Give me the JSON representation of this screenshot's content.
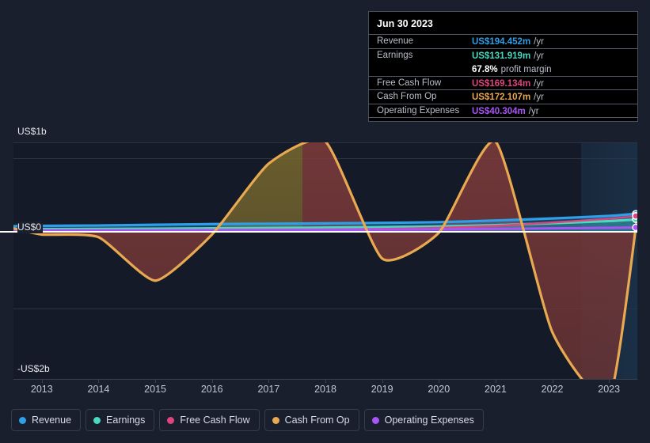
{
  "chart_data": {
    "type": "area",
    "title": "",
    "xlabel": "",
    "ylabel": "",
    "ylim": [
      -2000,
      1000
    ],
    "ytick_labels": [
      "US$1b",
      "US$0",
      "-US$2b"
    ],
    "ytick_values": [
      1000,
      0,
      -2000
    ],
    "grid": true,
    "x": [
      2012.5,
      2013,
      2014,
      2015,
      2016,
      2017,
      2018,
      2019,
      2020,
      2021,
      2022,
      2023,
      2023.5
    ],
    "categories": [
      "2013",
      "2014",
      "2015",
      "2016",
      "2017",
      "2018",
      "2019",
      "2020",
      "2021",
      "2022",
      "2023"
    ],
    "legend_position": "bottom",
    "forecast_band_start": "2022.6",
    "series": [
      {
        "name": "Revenue",
        "color": "#2e9fe8",
        "values": [
          55,
          58,
          62,
          70,
          78,
          82,
          86,
          92,
          100,
          118,
          142,
          170,
          194.452
        ]
      },
      {
        "name": "Earnings",
        "color": "#4ad9c0",
        "values": [
          20,
          22,
          24,
          26,
          30,
          34,
          38,
          44,
          52,
          66,
          88,
          112,
          131.919
        ]
      },
      {
        "name": "Free Cash Flow",
        "color": "#e0447e",
        "values": [
          8,
          10,
          12,
          12,
          14,
          16,
          18,
          24,
          36,
          58,
          96,
          138,
          169.134
        ]
      },
      {
        "name": "Cash From Op",
        "color": "#e8a951",
        "values": [
          30,
          -40,
          -70,
          -560,
          -40,
          760,
          1010,
          -310,
          -20,
          1010,
          -1140,
          -1900,
          172.107
        ]
      },
      {
        "name": "Operating Expenses",
        "color": "#a855f7",
        "values": [
          5,
          6,
          7,
          8,
          9,
          10,
          12,
          14,
          18,
          24,
          30,
          36,
          40.304
        ]
      }
    ]
  },
  "axis": {
    "y_top_label": "US$1b",
    "y_zero_label": "US$0",
    "y_bottom_label": "-US$2b",
    "x_labels": [
      "2013",
      "2014",
      "2015",
      "2016",
      "2017",
      "2018",
      "2019",
      "2020",
      "2021",
      "2022",
      "2023"
    ]
  },
  "legend": {
    "items": [
      {
        "label": "Revenue",
        "color": "#2e9fe8"
      },
      {
        "label": "Earnings",
        "color": "#4ad9c0"
      },
      {
        "label": "Free Cash Flow",
        "color": "#e0447e"
      },
      {
        "label": "Cash From Op",
        "color": "#e8a951"
      },
      {
        "label": "Operating Expenses",
        "color": "#a855f7"
      }
    ]
  },
  "tooltip": {
    "date": "Jun 30 2023",
    "rows": [
      {
        "label": "Revenue",
        "value": "US$194.452m",
        "unit": "/yr",
        "color": "#2e9fe8"
      },
      {
        "label": "Earnings",
        "value": "US$131.919m",
        "unit": "/yr",
        "color": "#4ad9c0"
      },
      {
        "label": "Free Cash Flow",
        "value": "US$169.134m",
        "unit": "/yr",
        "color": "#e0447e"
      },
      {
        "label": "Cash From Op",
        "value": "US$172.107m",
        "unit": "/yr",
        "color": "#e8a951"
      },
      {
        "label": "Operating Expenses",
        "value": "US$40.304m",
        "unit": "/yr",
        "color": "#a855f7"
      }
    ],
    "profit_margin_value": "67.8%",
    "profit_margin_label": "profit margin"
  },
  "colors": {
    "page_background": "#1a1f2e",
    "plot_background": "#151a28",
    "zero_line": "#ffffff",
    "gridline": "#2c3345",
    "forecast_band": "#224868"
  }
}
